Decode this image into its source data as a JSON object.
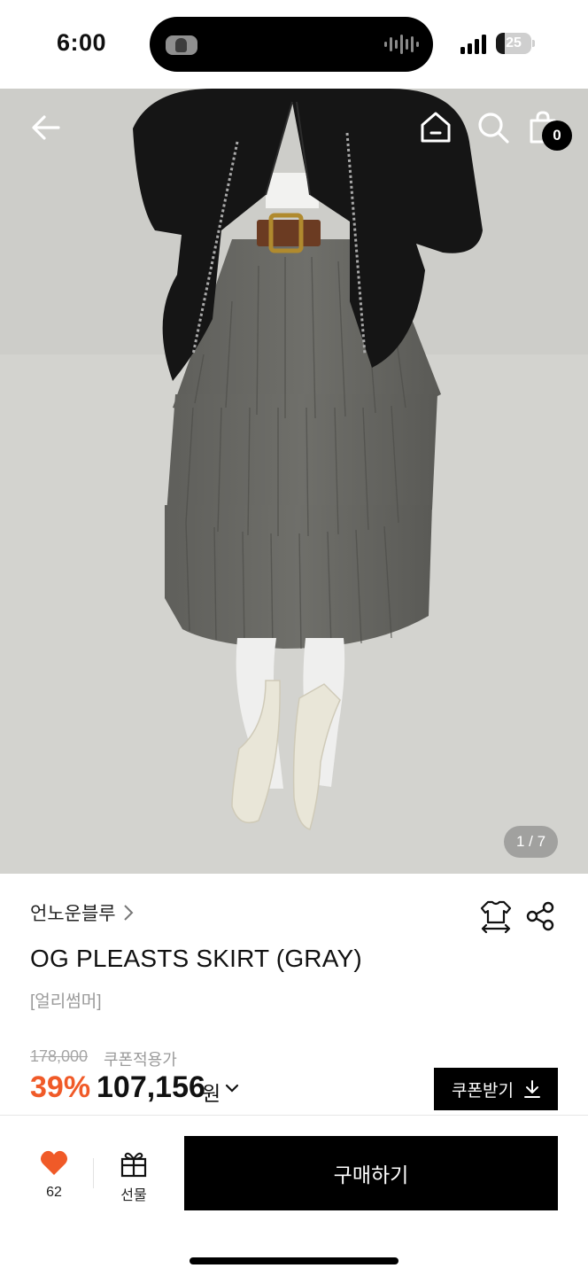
{
  "status_bar": {
    "time": "6:00",
    "battery_level": "25",
    "battery_fraction": 0.25
  },
  "top_nav": {
    "icons": [
      "back-arrow-icon",
      "home-icon",
      "search-icon",
      "shopping-bag-icon"
    ],
    "cart_count": "0"
  },
  "gallery": {
    "counter": "1 / 7",
    "current": 1,
    "total": 7
  },
  "product": {
    "brand": "언노운블루",
    "title": "OG PLEASTS SKIRT (GRAY)",
    "season": "[얼리썸머]",
    "original_price": "178,000",
    "coupon_label": "쿠폰적용가",
    "discount_rate": "39%",
    "sale_price": "107,156",
    "currency": "원",
    "coupon_button": "쿠폰받기"
  },
  "bottom_bar": {
    "like_count": "62",
    "gift_label": "선물",
    "buy_label": "구매하기"
  },
  "colors": {
    "accent_discount": "#f05a28",
    "like_heart": "#f05a28",
    "button_black": "#000000"
  }
}
